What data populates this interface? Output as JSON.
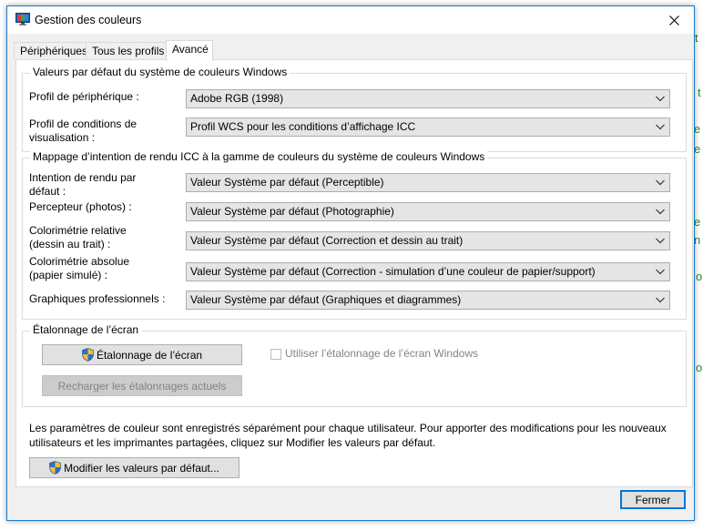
{
  "background_fragments": [
    "t",
    "t",
    "e",
    "e",
    "e",
    "n",
    "o",
    "o"
  ],
  "window": {
    "title": "Gestion des couleurs",
    "app_icon": "monitor-color-icon",
    "close_icon": "close-icon"
  },
  "tabs": [
    {
      "label": "Périphériques",
      "active": false
    },
    {
      "label": "Tous les profils",
      "active": false
    },
    {
      "label": "Avancé",
      "active": true
    }
  ],
  "defaults_group": {
    "title": "Valeurs par défaut du système de couleurs Windows",
    "device_profile": {
      "label": "Profil de périphérique :",
      "value": "Adobe RGB (1998)"
    },
    "viewing_conditions": {
      "label_line1": "Profil de conditions de",
      "label_line2": "visualisation :",
      "value": "Profil WCS pour les conditions d’affichage ICC"
    }
  },
  "mapping_group": {
    "title": "Mappage d’intention de rendu ICC à la gamme de couleurs du système de couleurs Windows",
    "rows": [
      {
        "label_line1": "Intention de rendu par",
        "label_line2": "défaut :",
        "value": "Valeur Système par défaut (Perceptible)"
      },
      {
        "label_line1": "Percepteur (photos) :",
        "label_line2": "",
        "value": "Valeur Système par défaut (Photographie)"
      },
      {
        "label_line1": "Colorimétrie relative",
        "label_line2": "(dessin au trait) :",
        "value": "Valeur Système par défaut (Correction et dessin au trait)"
      },
      {
        "label_line1": "Colorimétrie absolue",
        "label_line2": "(papier simulé) :",
        "value": "Valeur Système par défaut (Correction - simulation d’une couleur de papier/support)"
      },
      {
        "label_line1": "Graphiques professionnels :",
        "label_line2": "",
        "value": "Valeur Système par défaut (Graphiques et diagrammes)"
      }
    ]
  },
  "calibration_group": {
    "title": "Étalonnage de l’écran",
    "calibrate_button": "Étalonnage de l’écran",
    "reload_button": "Recharger les étalonnages actuels",
    "use_windows_calibration": {
      "label": "Utiliser l’étalonnage de l’écran Windows",
      "checked": false
    }
  },
  "info": {
    "line1": "Les paramètres de couleur sont enregistrés séparément pour chaque utilisateur. Pour apporter des modifications pour les nouveaux",
    "line2": "utilisateurs et les imprimantes partagées, cliquez sur Modifier les valeurs par défaut."
  },
  "change_defaults_button": "Modifier les valeurs par défaut...",
  "close_button": "Fermer",
  "colors": {
    "accent": "#0078d7",
    "window_border": "#1979ca",
    "background_text": "#2a8a2a",
    "shield_blue": "#2f6fc9",
    "shield_yellow": "#f2c12e"
  }
}
